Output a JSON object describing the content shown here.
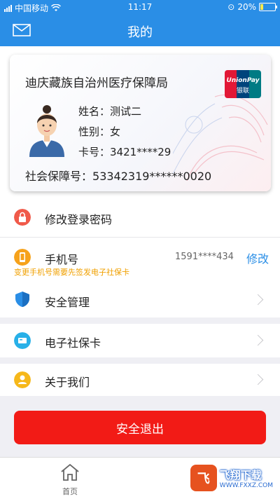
{
  "status_bar": {
    "carrier": "中国移动",
    "time": "11:17",
    "battery": "20%"
  },
  "nav": {
    "title": "我的",
    "mail_icon": "mail-icon"
  },
  "card": {
    "org": "迪庆藏族自治州医疗保障局",
    "brand_en": "UnionPay",
    "brand_cn": "银联",
    "name_label": "姓名：",
    "name_value": "测试二",
    "gender_label": "性别：",
    "gender_value": "女",
    "card_no_label": "卡号：",
    "card_no_value": "3421****29",
    "ssn_label": "社会保障号：",
    "ssn_value": "53342319******0020"
  },
  "menu": {
    "change_password": "修改登录密码",
    "phone_label": "手机号",
    "phone_value": "1591****434",
    "phone_action": "修改",
    "phone_hint": "变更手机号需要先签发电子社保卡",
    "security": "安全管理",
    "e_card": "电子社保卡",
    "about": "关于我们"
  },
  "logout": "安全退出",
  "tabbar": {
    "home": "首页"
  },
  "watermark": {
    "logo": "飞",
    "name": "飞翔下载",
    "url": "WWW.FXXZ.COM"
  },
  "colors": {
    "primary": "#2a8ee6",
    "danger": "#f21b16",
    "hint": "#f0a000"
  }
}
